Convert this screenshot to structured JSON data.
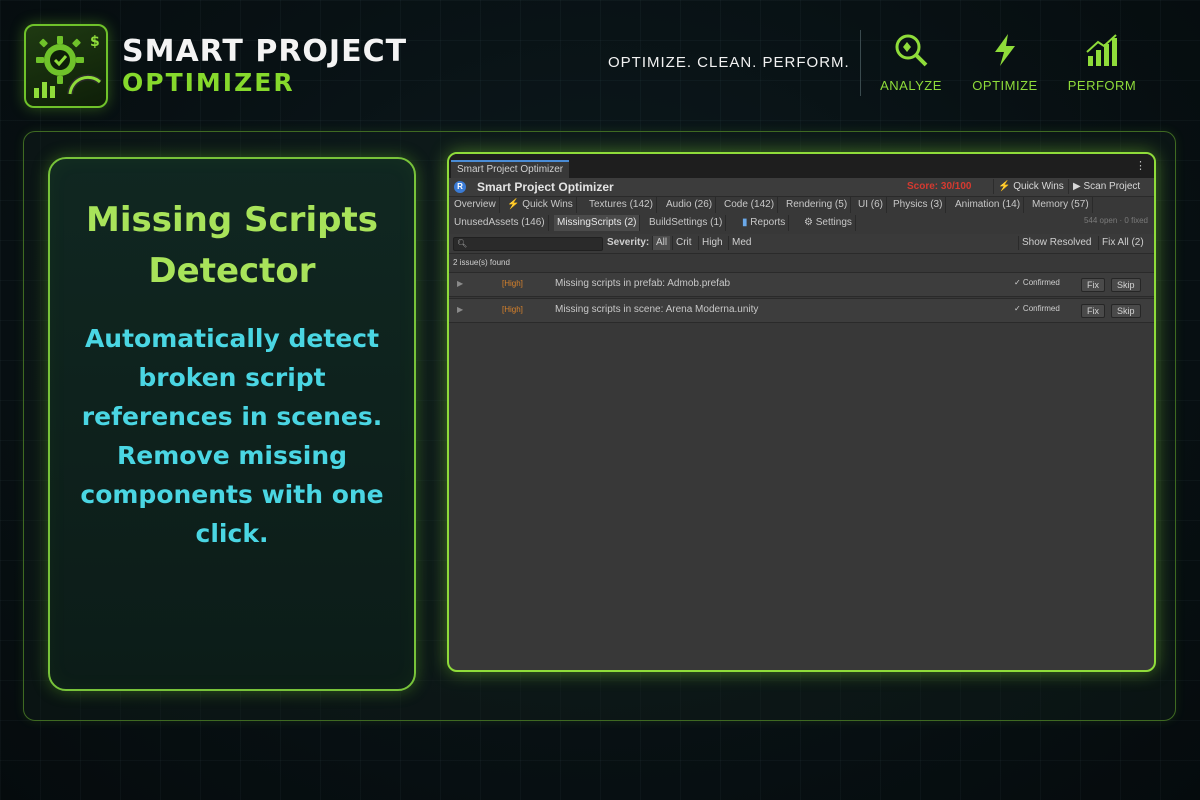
{
  "brand": {
    "title": "SMART PROJECT",
    "subtitle": "OPTIMIZER",
    "tagline": "OPTIMIZE. CLEAN. PERFORM.",
    "accent": "#86d92c",
    "icon": "gear-gauge-logo-icon"
  },
  "features": [
    {
      "label": "ANALYZE",
      "icon": "magnify-icon"
    },
    {
      "label": "OPTIMIZE",
      "icon": "lightning-icon"
    },
    {
      "label": "PERFORM",
      "icon": "growth-chart-icon"
    }
  ],
  "card": {
    "title": "Missing Scripts Detector",
    "description": "Automatically detect broken script references in scenes.\nRemove missing components with one click.",
    "title_color": "#a8e35a",
    "desc_color": "#4ad6e3"
  },
  "window": {
    "tab_title": "Smart Project Optimizer",
    "menu_icon": "⋮",
    "plugin_title": "Smart Project Optimizer",
    "score": "Score: 30/100",
    "quick_wins": "Quick Wins",
    "scan_project": "Scan Project",
    "tabs_row1": [
      {
        "label": "Overview"
      },
      {
        "label": "Quick Wins"
      },
      {
        "label": "Textures (142)"
      },
      {
        "label": "Audio (26)"
      },
      {
        "label": "Code (142)"
      },
      {
        "label": "Rendering (5)"
      },
      {
        "label": "UI (6)"
      },
      {
        "label": "Physics (3)"
      },
      {
        "label": "Animation (14)"
      },
      {
        "label": "Memory (57)"
      }
    ],
    "tabs_row2": [
      {
        "label": "UnusedAssets (146)"
      },
      {
        "label": "MissingScripts (2)"
      },
      {
        "label": "BuildSettings (1)"
      },
      {
        "label": "Reports"
      },
      {
        "label": "Settings"
      }
    ],
    "status": "544 open · 0 fixed",
    "severity_label": "Severity:",
    "severity_options": [
      "All",
      "Crit",
      "High",
      "Med"
    ],
    "show_resolved": "Show Resolved",
    "fix_all": "Fix All (2)",
    "issue_count": "2 issue(s) found",
    "issues": [
      {
        "severity": "[High]",
        "message": "Missing scripts in prefab: Admob.prefab",
        "status": "✓ Confirmed",
        "fix": "Fix",
        "skip": "Skip"
      },
      {
        "severity": "[High]",
        "message": "Missing scripts in scene: Arena Moderna.unity",
        "status": "✓ Confirmed",
        "fix": "Fix",
        "skip": "Skip"
      }
    ]
  }
}
